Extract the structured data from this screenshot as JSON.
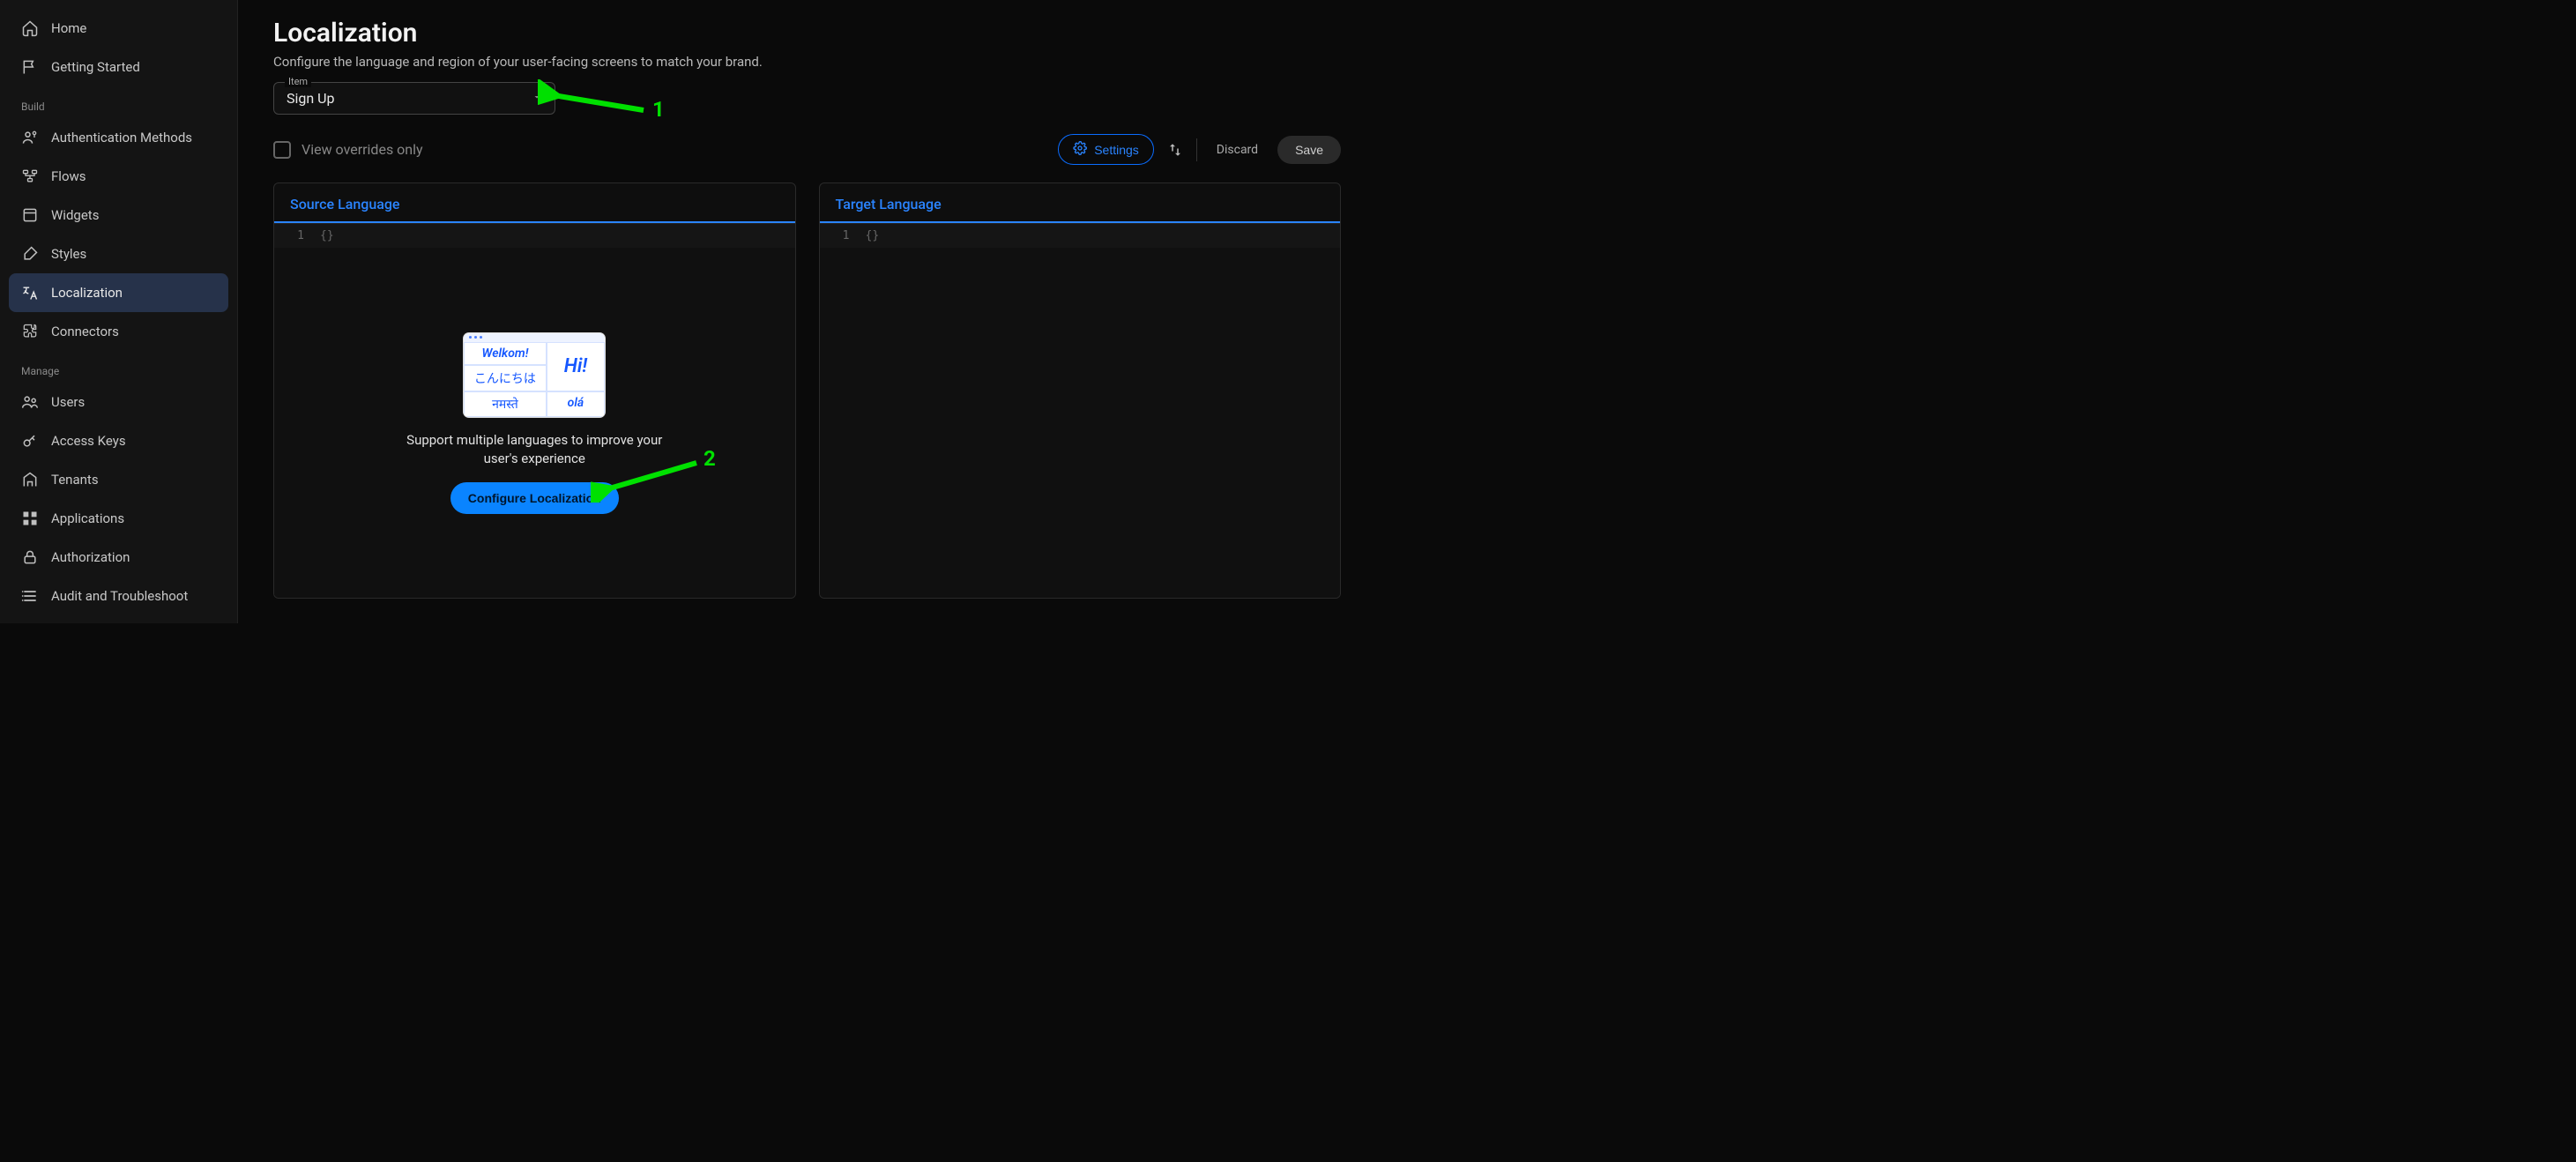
{
  "sidebar": {
    "top": [
      {
        "icon": "home",
        "label": "Home"
      },
      {
        "icon": "flag",
        "label": "Getting Started"
      }
    ],
    "build_label": "Build",
    "build": [
      {
        "icon": "person-key",
        "label": "Authentication Methods"
      },
      {
        "icon": "flows",
        "label": "Flows"
      },
      {
        "icon": "widget",
        "label": "Widgets"
      },
      {
        "icon": "brush",
        "label": "Styles"
      },
      {
        "icon": "translate",
        "label": "Localization",
        "active": true
      },
      {
        "icon": "puzzle",
        "label": "Connectors"
      }
    ],
    "manage_label": "Manage",
    "manage": [
      {
        "icon": "users",
        "label": "Users"
      },
      {
        "icon": "key",
        "label": "Access Keys"
      },
      {
        "icon": "building",
        "label": "Tenants"
      },
      {
        "icon": "apps",
        "label": "Applications"
      },
      {
        "icon": "lock",
        "label": "Authorization"
      },
      {
        "icon": "list",
        "label": "Audit and Troubleshoot"
      }
    ]
  },
  "page": {
    "title": "Localization",
    "subtitle": "Configure the language and region of your user-facing screens to match your brand."
  },
  "itemSelect": {
    "label": "Item",
    "value": "Sign Up"
  },
  "overrides": {
    "label": "View overrides only",
    "checked": false
  },
  "toolbar": {
    "settings": "Settings",
    "discard": "Discard",
    "save": "Save"
  },
  "sourcePanel": {
    "tab": "Source Language",
    "line": "1",
    "content": "{}"
  },
  "targetPanel": {
    "tab": "Target Language",
    "line": "1",
    "content": "{}"
  },
  "emptyState": {
    "cells": [
      "Welkom!",
      "Hi!",
      "こんにちは",
      "",
      "नमस्ते",
      "olá"
    ],
    "text": "Support multiple languages to improve your user's experience",
    "button": "Configure Localization"
  },
  "annotations": {
    "a1": "1",
    "a2": "2"
  }
}
